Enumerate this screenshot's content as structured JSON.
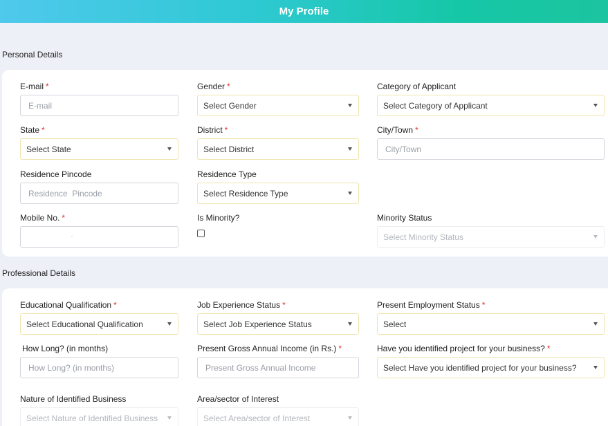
{
  "header": {
    "title": "My Profile"
  },
  "sections": {
    "personal": {
      "title": "Personal Details"
    },
    "professional": {
      "title": "Professional Details"
    }
  },
  "required_marker": "*",
  "fields": {
    "email": {
      "label": "E-mail",
      "placeholder": "E-mail"
    },
    "gender": {
      "label": "Gender",
      "value": "Select Gender"
    },
    "category": {
      "label": "Category of Applicant",
      "value": "Select Category of Applicant"
    },
    "state": {
      "label": "State",
      "value": "Select State"
    },
    "district": {
      "label": "District",
      "value": "Select District"
    },
    "city": {
      "label": "City/Town",
      "placeholder": "City/Town"
    },
    "pincode": {
      "label": "Residence Pincode",
      "placeholder": "Residence  Pincode"
    },
    "residence_type": {
      "label": "Residence Type",
      "value": "Select Residence Type"
    },
    "mobile": {
      "label": "Mobile No.",
      "value": ""
    },
    "is_minority": {
      "label": "Is Minority?",
      "checked": false
    },
    "minority_status": {
      "label": "Minority Status",
      "value": "Select Minority Status"
    },
    "education": {
      "label": "Educational Qualification",
      "value": "Select Educational Qualification"
    },
    "job_experience": {
      "label": "Job Experience Status",
      "value": "Select Job Experience Status"
    },
    "employment": {
      "label": "Present Employment Status",
      "value": "Select"
    },
    "how_long": {
      "label": "How Long? (in months)",
      "placeholder": "How Long? (in months)"
    },
    "income": {
      "label": "Present Gross Annual Income (in Rs.)",
      "placeholder": "Present Gross Annual Income"
    },
    "project": {
      "label": "Have you identified project for your business?",
      "value": "Select Have you identified project for your business?"
    },
    "nature": {
      "label": "Nature of Identified Business",
      "value": "Select Nature of Identified Business"
    },
    "area": {
      "label": "Area/sector of Interest",
      "value": "Select Area/sector of Interest"
    }
  }
}
